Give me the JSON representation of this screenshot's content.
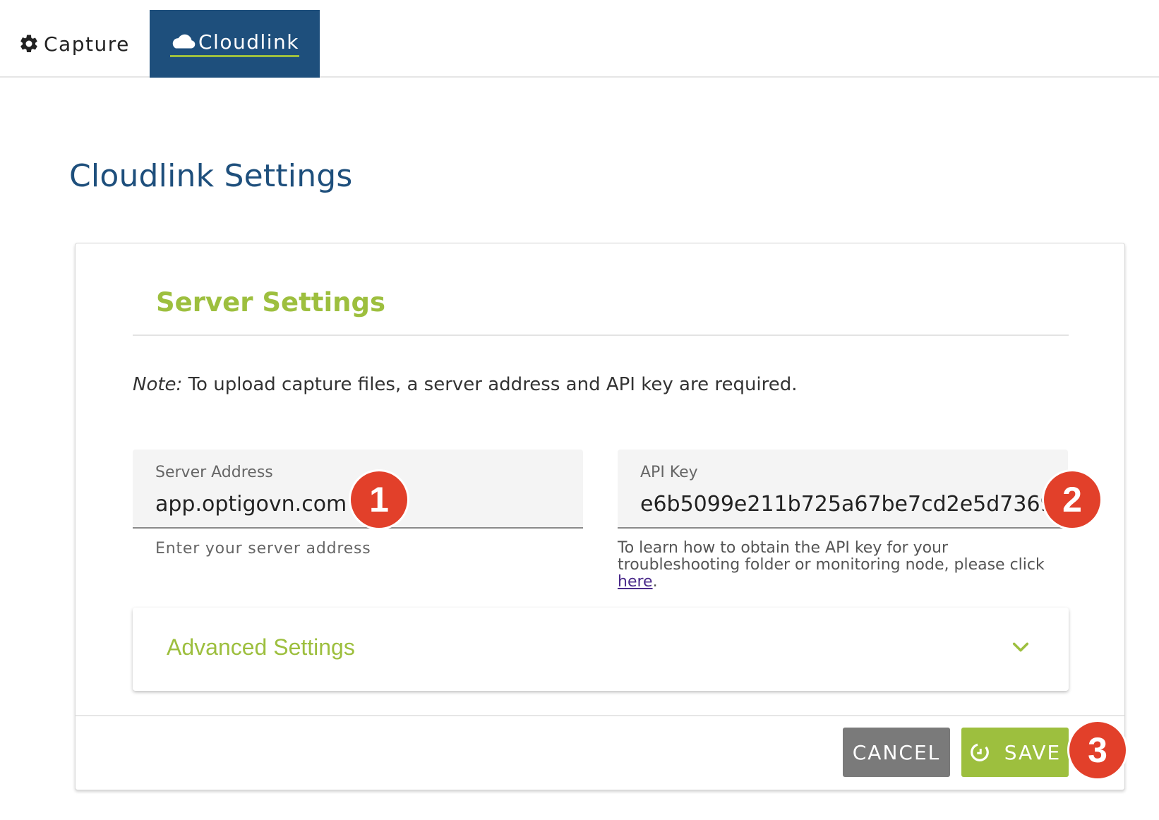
{
  "nav": {
    "tabs": [
      {
        "label": "Capture",
        "icon": "gear-icon",
        "active": false
      },
      {
        "label": "Cloudlink",
        "icon": "cloud-icon",
        "active": true
      }
    ]
  },
  "page": {
    "title": "Cloudlink Settings"
  },
  "server_settings": {
    "title": "Server Settings",
    "note_prefix": "Note:",
    "note_text": " To upload capture files, a server address and API key are required.",
    "server_address": {
      "label": "Server Address",
      "value": "app.optigovn.com",
      "helper": "Enter your server address"
    },
    "api_key": {
      "label": "API Key",
      "value": "e6b5099e211b725a67be7cd2e5d7369f",
      "helper_text": "To learn how to obtain the API key for your troubleshooting folder or monitoring node, please click ",
      "helper_link": "here",
      "helper_end": "."
    }
  },
  "advanced": {
    "label": "Advanced Settings",
    "icon": "chevron-down-icon"
  },
  "actions": {
    "cancel_label": "CANCEL",
    "save_label": "SAVE",
    "save_icon": "refresh-icon"
  },
  "annotations": {
    "badge_1": "1",
    "badge_2": "2",
    "badge_3": "3"
  },
  "colors": {
    "brand_blue": "#1e4f7c",
    "accent_green": "#9dbf3e",
    "badge_red": "#e2402a",
    "cancel_gray": "#7a7a7a"
  }
}
